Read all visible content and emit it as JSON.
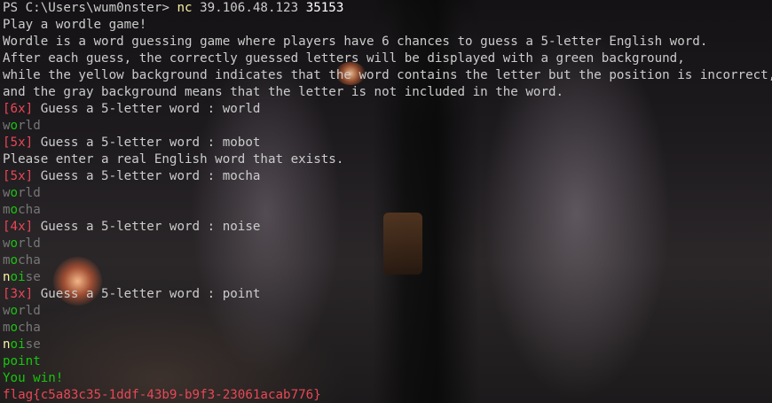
{
  "terminal": {
    "prompt": "PS C:\\Users\\wum0nster> ",
    "command": "nc",
    "host": " 39.106.48.123 ",
    "port": "35153",
    "intro": [
      "Play a wordle game!",
      "Wordle is a word guessing game where players have 6 chances to guess a 5-letter English word.",
      "After each guess, the correctly guessed letters will be displayed with a green background,",
      "while the yellow background indicates that the word contains the letter but the position is incorrect,",
      "and the gray background means that the letter is not included in the word."
    ],
    "prompt_text": " Guess a 5-letter word : ",
    "rounds": [
      {
        "count": "[6x]",
        "input": "world",
        "history": [
          [
            {
              "ch": "w",
              "s": "d"
            },
            {
              "ch": "o",
              "s": "g"
            },
            {
              "ch": "r",
              "s": "d"
            },
            {
              "ch": "l",
              "s": "d"
            },
            {
              "ch": "d",
              "s": "d"
            }
          ]
        ]
      },
      {
        "count": "[5x]",
        "input": "mobot",
        "message": "Please enter a real English word that exists."
      },
      {
        "count": "[5x]",
        "input": "mocha",
        "history": [
          [
            {
              "ch": "w",
              "s": "d"
            },
            {
              "ch": "o",
              "s": "g"
            },
            {
              "ch": "r",
              "s": "d"
            },
            {
              "ch": "l",
              "s": "d"
            },
            {
              "ch": "d",
              "s": "d"
            }
          ],
          [
            {
              "ch": "m",
              "s": "d"
            },
            {
              "ch": "o",
              "s": "g"
            },
            {
              "ch": "c",
              "s": "d"
            },
            {
              "ch": "h",
              "s": "d"
            },
            {
              "ch": "a",
              "s": "d"
            }
          ]
        ]
      },
      {
        "count": "[4x]",
        "input": "noise",
        "history": [
          [
            {
              "ch": "w",
              "s": "d"
            },
            {
              "ch": "o",
              "s": "g"
            },
            {
              "ch": "r",
              "s": "d"
            },
            {
              "ch": "l",
              "s": "d"
            },
            {
              "ch": "d",
              "s": "d"
            }
          ],
          [
            {
              "ch": "m",
              "s": "d"
            },
            {
              "ch": "o",
              "s": "g"
            },
            {
              "ch": "c",
              "s": "d"
            },
            {
              "ch": "h",
              "s": "d"
            },
            {
              "ch": "a",
              "s": "d"
            }
          ],
          [
            {
              "ch": "n",
              "s": "y"
            },
            {
              "ch": "o",
              "s": "g"
            },
            {
              "ch": "i",
              "s": "g"
            },
            {
              "ch": "s",
              "s": "d"
            },
            {
              "ch": "e",
              "s": "d"
            }
          ]
        ]
      },
      {
        "count": "[3x]",
        "input": "point",
        "history": [
          [
            {
              "ch": "w",
              "s": "d"
            },
            {
              "ch": "o",
              "s": "g"
            },
            {
              "ch": "r",
              "s": "d"
            },
            {
              "ch": "l",
              "s": "d"
            },
            {
              "ch": "d",
              "s": "d"
            }
          ],
          [
            {
              "ch": "m",
              "s": "d"
            },
            {
              "ch": "o",
              "s": "g"
            },
            {
              "ch": "c",
              "s": "d"
            },
            {
              "ch": "h",
              "s": "d"
            },
            {
              "ch": "a",
              "s": "d"
            }
          ],
          [
            {
              "ch": "n",
              "s": "y"
            },
            {
              "ch": "o",
              "s": "g"
            },
            {
              "ch": "i",
              "s": "g"
            },
            {
              "ch": "s",
              "s": "d"
            },
            {
              "ch": "e",
              "s": "d"
            }
          ],
          [
            {
              "ch": "p",
              "s": "g"
            },
            {
              "ch": "o",
              "s": "g"
            },
            {
              "ch": "i",
              "s": "g"
            },
            {
              "ch": "n",
              "s": "g"
            },
            {
              "ch": "t",
              "s": "g"
            }
          ]
        ]
      }
    ],
    "win_text": "You win!",
    "flag": "flag{c5a83c35-1ddf-43b9-b9f3-23061acab776}"
  },
  "colors": {
    "green": "#16c60c",
    "yellow": "#f9f1a5",
    "gray": "#767676",
    "red": "#e74856",
    "text": "#cccccc"
  }
}
